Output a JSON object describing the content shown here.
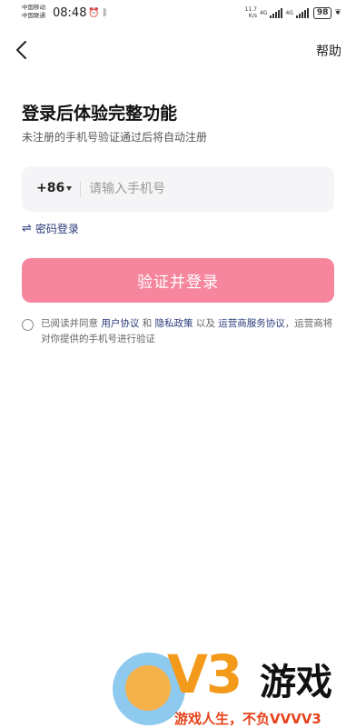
{
  "status_bar": {
    "carrier_1": "中国移动",
    "carrier_2": "中国联通",
    "time": "08:48",
    "net_speed_value": "11.7",
    "net_speed_unit": "K/s",
    "network_type": "4G",
    "battery": "98"
  },
  "nav": {
    "back_icon": "chevron-left-icon",
    "help_label": "帮助"
  },
  "heading": {
    "title": "登录后体验完整功能",
    "subtitle": "未注册的手机号验证通过后将自动注册"
  },
  "phone": {
    "country_code": "+86",
    "placeholder": "请输入手机号",
    "value": ""
  },
  "password_login": {
    "icon": "swap-icon",
    "label": "密码登录"
  },
  "verify_button": {
    "label": "验证并登录",
    "color": "#f6869e"
  },
  "agreement": {
    "checked": false,
    "prefix": "已阅读并同意",
    "user_agreement": "用户协议",
    "and": "和",
    "privacy_policy": "隐私政策",
    "and_also": "以及",
    "operator_agreement": "运营商服务协议",
    "suffix": "，运营商将对你提供的手机号进行验证",
    "link_color": "#2a3b7a"
  },
  "watermark": {
    "logo_letters": "V3",
    "logo_text": "游戏",
    "slogan": "游戏人生，不负VVVV3"
  }
}
